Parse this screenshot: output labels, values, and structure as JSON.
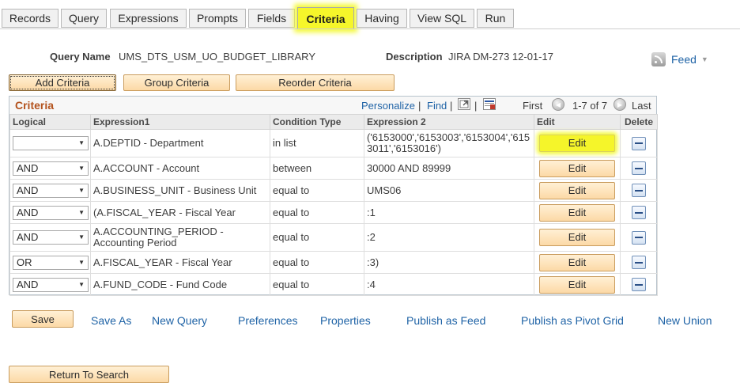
{
  "tabs": [
    {
      "label": "Records",
      "active": false
    },
    {
      "label": "Query",
      "active": false
    },
    {
      "label": "Expressions",
      "active": false
    },
    {
      "label": "Prompts",
      "active": false
    },
    {
      "label": "Fields",
      "active": false
    },
    {
      "label": "Criteria",
      "active": true
    },
    {
      "label": "Having",
      "active": false
    },
    {
      "label": "View SQL",
      "active": false
    },
    {
      "label": "Run",
      "active": false
    }
  ],
  "header": {
    "query_name_label": "Query Name",
    "query_name_value": "UMS_DTS_USM_UO_BUDGET_LIBRARY",
    "description_label": "Description",
    "description_value": "JIRA DM-273 12-01-17",
    "feed_label": "Feed"
  },
  "actions": {
    "add_criteria": "Add Criteria",
    "group_criteria": "Group Criteria",
    "reorder_criteria": "Reorder Criteria"
  },
  "grid": {
    "title": "Criteria",
    "personalize": "Personalize",
    "find": "Find",
    "separator": "|",
    "first": "First",
    "range": "1-7 of 7",
    "last": "Last",
    "columns": [
      "Logical",
      "Expression1",
      "Condition Type",
      "Expression 2",
      "Edit",
      "Delete"
    ],
    "rows": [
      {
        "logical": "",
        "expression1": "A.DEPTID - Department",
        "condition": "in list",
        "expression2": "('6153000','6153003','6153004','6153011','6153016')",
        "edit": "Edit",
        "highlight": true
      },
      {
        "logical": "AND",
        "expression1": "A.ACCOUNT - Account",
        "condition": "between",
        "expression2": "30000 AND 89999",
        "edit": "Edit",
        "highlight": false
      },
      {
        "logical": "AND",
        "expression1": "A.BUSINESS_UNIT - Business Unit",
        "condition": "equal to",
        "expression2": "UMS06",
        "edit": "Edit",
        "highlight": false
      },
      {
        "logical": "AND",
        "expression1": "(A.FISCAL_YEAR - Fiscal Year",
        "condition": "equal to",
        "expression2": ":1",
        "edit": "Edit",
        "highlight": false
      },
      {
        "logical": "AND",
        "expression1": "A.ACCOUNTING_PERIOD - Accounting Period",
        "condition": "equal to",
        "expression2": ":2",
        "edit": "Edit",
        "highlight": false
      },
      {
        "logical": "OR",
        "expression1": "A.FISCAL_YEAR - Fiscal Year",
        "condition": "equal to",
        "expression2": ":3)",
        "edit": "Edit",
        "highlight": false
      },
      {
        "logical": "AND",
        "expression1": "A.FUND_CODE - Fund Code",
        "condition": "equal to",
        "expression2": ":4",
        "edit": "Edit",
        "highlight": false
      }
    ]
  },
  "footer": {
    "save": "Save",
    "save_as": "Save As",
    "new_query": "New Query",
    "preferences": "Preferences",
    "properties": "Properties",
    "publish_as_feed": "Publish as Feed",
    "publish_as_pivot_grid": "Publish as Pivot Grid",
    "new_union": "New Union",
    "return_to_search": "Return To Search"
  },
  "colors": {
    "highlight": "#f5f52a",
    "link": "#1f63a6",
    "grid_title": "#b3521d",
    "button_bg": "#fcd9a6"
  },
  "icons": [
    "rss-feed-icon",
    "zoom-grid-icon",
    "download-grid-icon",
    "first-page-icon",
    "last-page-icon",
    "delete-row-icon",
    "dropdown-arrow-icon"
  ]
}
